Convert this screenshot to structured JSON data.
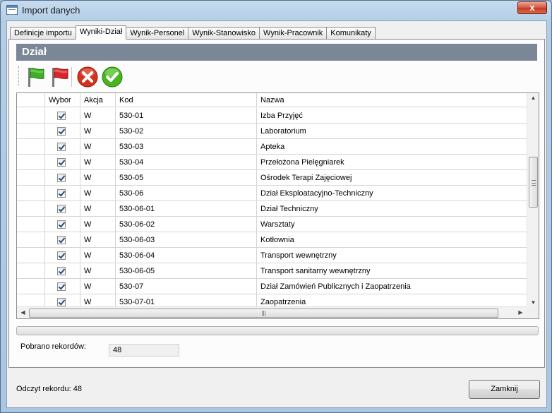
{
  "window": {
    "title": "Import danych",
    "close_glyph": "x"
  },
  "tabs": [
    {
      "label": "Definicje importu",
      "active": false
    },
    {
      "label": "Wyniki-Dział",
      "active": true
    },
    {
      "label": "Wynik-Personel",
      "active": false
    },
    {
      "label": "Wynik-Stanowisko",
      "active": false
    },
    {
      "label": "Wynik-Pracownik",
      "active": false
    },
    {
      "label": "Komunikaty",
      "active": false
    }
  ],
  "section": {
    "title": "Dział"
  },
  "toolbar": {
    "buttons": [
      {
        "icon": "green-flag-icon",
        "color": "#3fae2a"
      },
      {
        "icon": "red-flag-icon",
        "color": "#d8262a"
      },
      {
        "icon": "cancel-icon",
        "color": "#d2321f"
      },
      {
        "icon": "accept-icon",
        "color": "#46b51e"
      }
    ]
  },
  "grid": {
    "columns": [
      "Wybor",
      "Akcja",
      "Kod",
      "Nazwa"
    ],
    "rows": [
      {
        "selected": true,
        "akcja": "W",
        "kod": "530-01",
        "nazwa": "Izba Przyjęć"
      },
      {
        "selected": true,
        "akcja": "W",
        "kod": "530-02",
        "nazwa": "Laboratorium"
      },
      {
        "selected": true,
        "akcja": "W",
        "kod": "530-03",
        "nazwa": "Apteka"
      },
      {
        "selected": true,
        "akcja": "W",
        "kod": "530-04",
        "nazwa": "Przełożona Pielęgniarek"
      },
      {
        "selected": true,
        "akcja": "W",
        "kod": "530-05",
        "nazwa": "Ośrodek Terapi Zajęciowej"
      },
      {
        "selected": true,
        "akcja": "W",
        "kod": "530-06",
        "nazwa": "Dział Eksploatacyjno-Techniczny"
      },
      {
        "selected": true,
        "akcja": "W",
        "kod": "530-06-01",
        "nazwa": "Dział Techniczny"
      },
      {
        "selected": true,
        "akcja": "W",
        "kod": "530-06-02",
        "nazwa": "Warsztaty"
      },
      {
        "selected": true,
        "akcja": "W",
        "kod": "530-06-03",
        "nazwa": "Kotłownia"
      },
      {
        "selected": true,
        "akcja": "W",
        "kod": "530-06-04",
        "nazwa": "Transport wewnętrzny"
      },
      {
        "selected": true,
        "akcja": "W",
        "kod": "530-06-05",
        "nazwa": "Transport sanitarny wewnętrzny"
      },
      {
        "selected": true,
        "akcja": "W",
        "kod": "530-07",
        "nazwa": "Dział Zamówień Publicznych i Zaopatrzenia"
      },
      {
        "selected": true,
        "akcja": "W",
        "kod": "530-07-01",
        "nazwa": "Zaopatrzenia"
      }
    ]
  },
  "records": {
    "label": "Pobrano rekordów:",
    "value": "48"
  },
  "status": {
    "text": "Odczyt rekordu: 48"
  },
  "buttons": {
    "close_label": "Zamknij"
  }
}
